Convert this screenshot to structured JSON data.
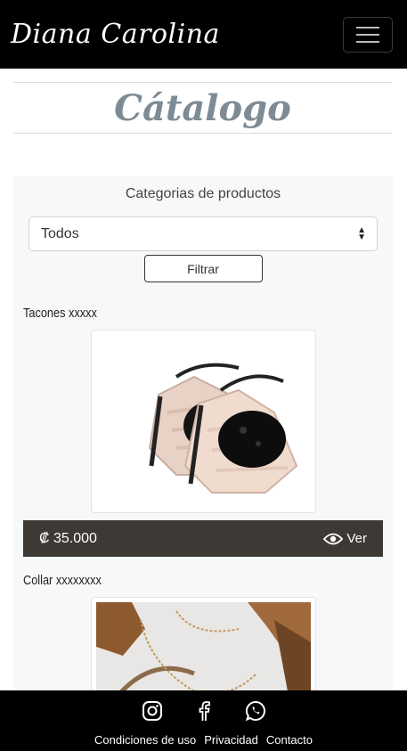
{
  "navbar": {
    "brand": "Diana Carolina",
    "menu_icon": "hamburger-icon"
  },
  "page": {
    "title": "Cátalogo"
  },
  "filter": {
    "category_label": "Categorias de productos",
    "selected_option": "Todos",
    "filter_button": "Filtrar"
  },
  "products": [
    {
      "name": "Tacones xxxxx",
      "price": "₡ 35.000",
      "view_label": "Ver"
    },
    {
      "name": "Collar xxxxxxxx"
    }
  ],
  "footer": {
    "social_icons": [
      "instagram-icon",
      "facebook-icon",
      "whatsapp-icon"
    ],
    "links": [
      "Condiciones de uso",
      "Privacidad",
      "Contacto"
    ]
  },
  "colors": {
    "navbar_bg": "#000000",
    "price_bar_bg": "#3d3935",
    "title_color": "#7d8b94",
    "panel_bg": "#f7f8fa"
  }
}
